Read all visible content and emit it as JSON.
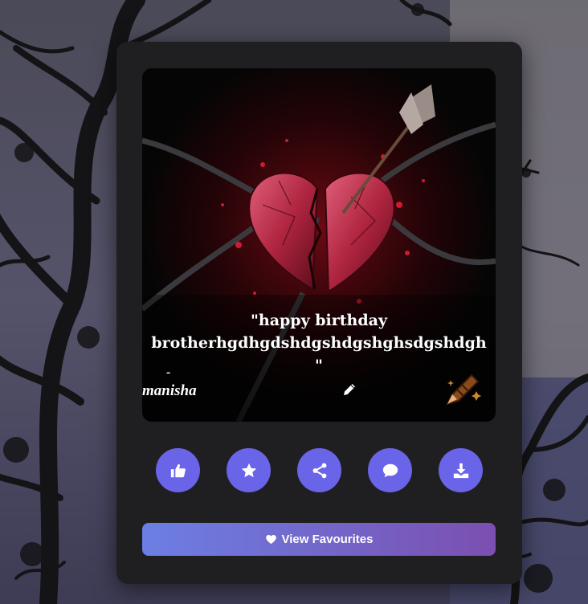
{
  "quote": {
    "text": "\"happy birthday brotherhgdhgdshdgshdgshghsdgshdgh\"",
    "author_dash": "-",
    "author_name": "manisha"
  },
  "actions": [
    {
      "name": "like-button",
      "icon": "thumbs-up-icon"
    },
    {
      "name": "favorite-button",
      "icon": "star-icon"
    },
    {
      "name": "share-button",
      "icon": "share-icon"
    },
    {
      "name": "comment-button",
      "icon": "comment-icon"
    },
    {
      "name": "download-button",
      "icon": "download-icon"
    }
  ],
  "view_favourites": {
    "label": "View Favourites",
    "icon": "heart-icon"
  },
  "colors": {
    "card_bg": "#1f1f21",
    "action_btn": "#6a64e8",
    "fav_gradient_start": "#6c7fe4",
    "fav_gradient_end": "#7b4fb0"
  }
}
